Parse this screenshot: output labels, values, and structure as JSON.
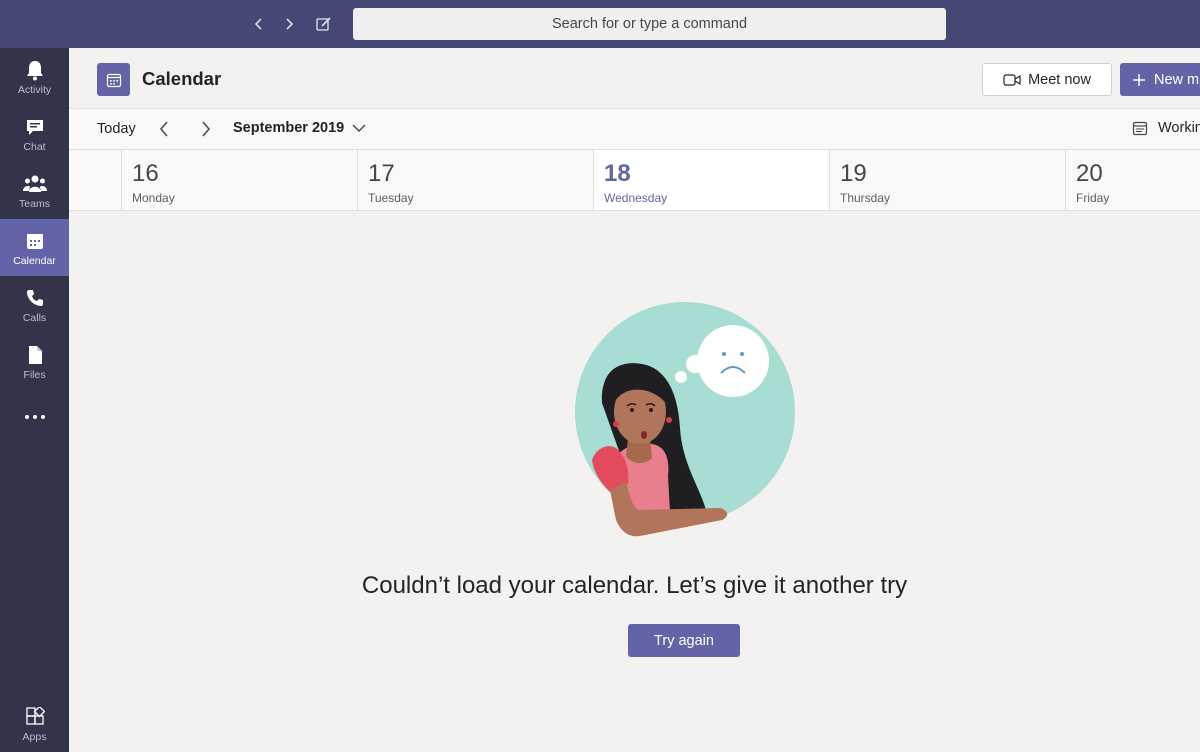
{
  "titlebar": {
    "search_placeholder": "Search for or type a command",
    "back_icon": "chevron-left-icon",
    "forward_icon": "chevron-right-icon",
    "compose_icon": "compose-icon"
  },
  "rail": {
    "items": [
      {
        "label": "Activity",
        "icon": "bell-icon"
      },
      {
        "label": "Chat",
        "icon": "chat-icon"
      },
      {
        "label": "Teams",
        "icon": "teams-icon"
      },
      {
        "label": "Calendar",
        "icon": "calendar-icon",
        "active": true
      },
      {
        "label": "Calls",
        "icon": "phone-icon"
      },
      {
        "label": "Files",
        "icon": "file-icon"
      }
    ],
    "more_icon": "more-icon",
    "apps_label": "Apps"
  },
  "header": {
    "title": "Calendar",
    "meet_now_label": "Meet now",
    "new_meeting_label": "New m"
  },
  "toolbar": {
    "today_label": "Today",
    "month_label": "September 2019",
    "working_label": "Working"
  },
  "days": [
    {
      "num": "16",
      "name": "Monday"
    },
    {
      "num": "17",
      "name": "Tuesday"
    },
    {
      "num": "18",
      "name": "Wednesday",
      "current": true
    },
    {
      "num": "19",
      "name": "Thursday"
    },
    {
      "num": "20",
      "name": "Friday"
    }
  ],
  "error": {
    "message": "Couldn’t load your calendar. Let’s give it another try",
    "retry_label": "Try again"
  },
  "colors": {
    "brand": "#6264a7",
    "titlebar": "#464775",
    "rail": "#33344a",
    "background": "#f3f2f1"
  }
}
